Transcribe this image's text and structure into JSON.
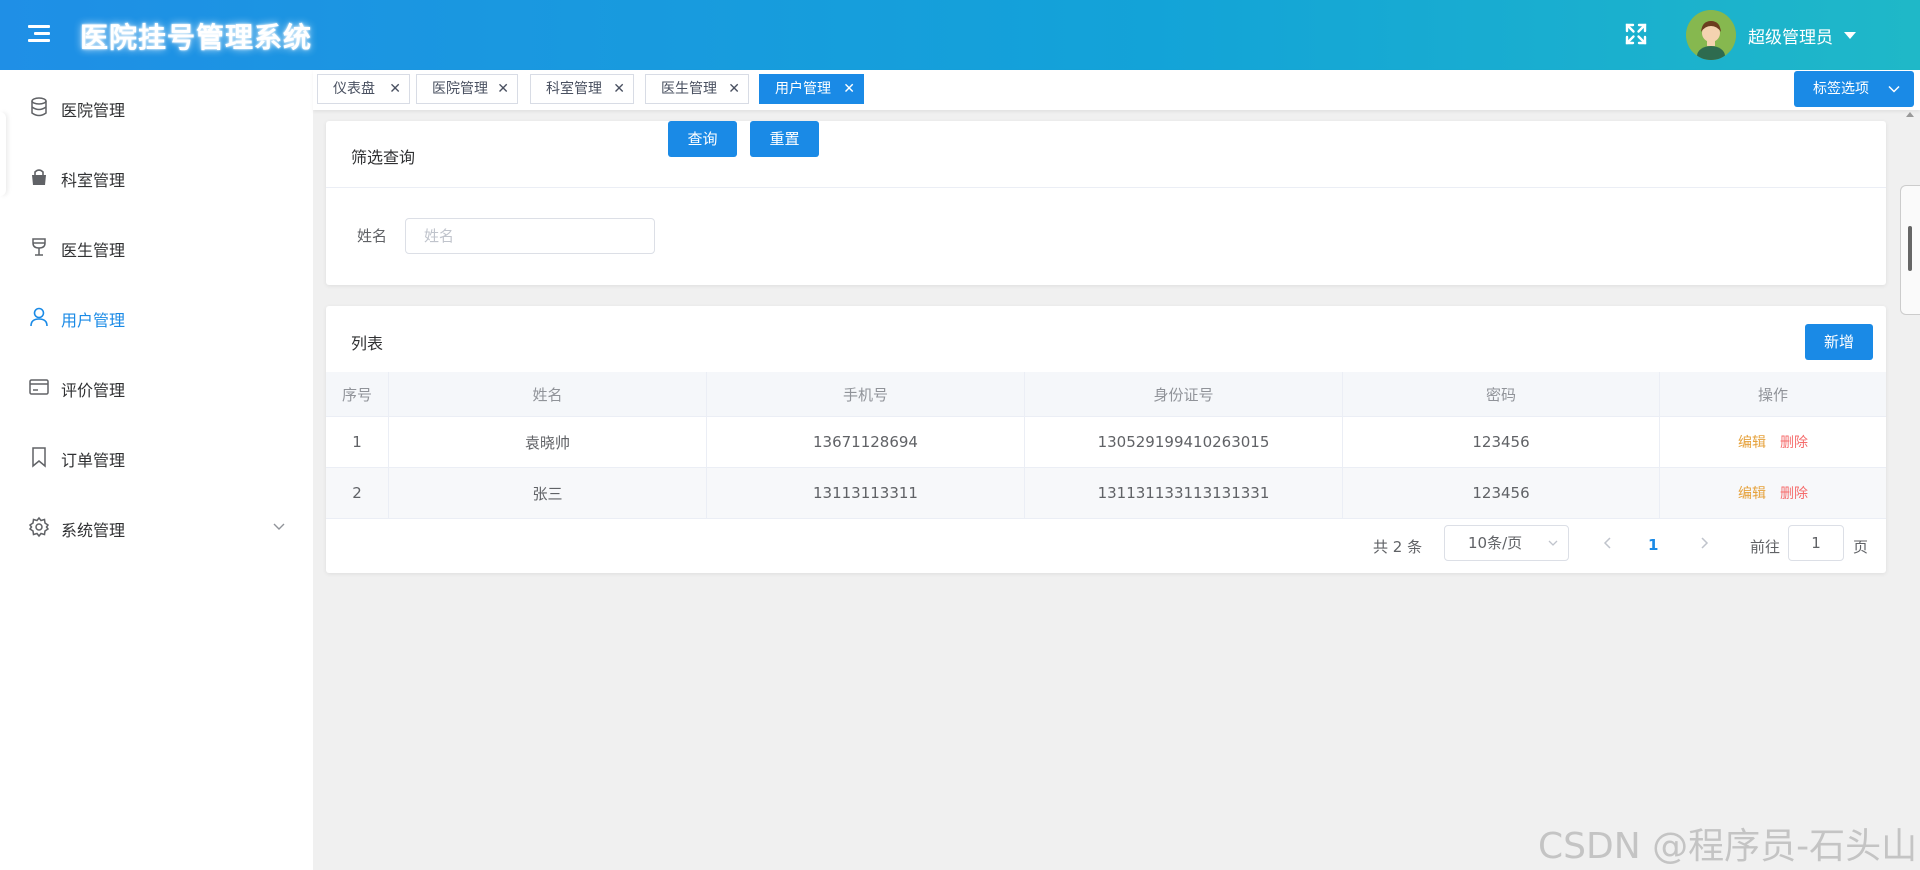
{
  "header": {
    "title": "医院挂号管理系统",
    "user_name": "超级管理员",
    "icons": {
      "menu": "menu-toggle-icon",
      "fullscreen": "fullscreen-icon",
      "dropdown": "caret-down-icon"
    }
  },
  "sidebar": {
    "items": [
      {
        "label": "医院管理",
        "icon": "database-icon"
      },
      {
        "label": "科室管理",
        "icon": "bag-icon"
      },
      {
        "label": "医生管理",
        "icon": "glass-icon"
      },
      {
        "label": "用户管理",
        "icon": "user-icon",
        "active": true
      },
      {
        "label": "评价管理",
        "icon": "card-icon"
      },
      {
        "label": "订单管理",
        "icon": "bookmark-icon"
      },
      {
        "label": "系统管理",
        "icon": "gear-icon",
        "expandable": true
      }
    ]
  },
  "tabs": {
    "items": [
      {
        "label": "仪表盘"
      },
      {
        "label": "医院管理"
      },
      {
        "label": "科室管理"
      },
      {
        "label": "医生管理"
      },
      {
        "label": "用户管理",
        "active": true
      }
    ],
    "options_label": "标签选项"
  },
  "filter": {
    "title": "筛选查询",
    "name_label": "姓名",
    "name_placeholder": "姓名",
    "name_value": "",
    "query_button": "查询",
    "reset_button": "重置"
  },
  "list": {
    "title": "列表",
    "add_button": "新增",
    "columns": [
      "序号",
      "姓名",
      "手机号",
      "身份证号",
      "密码",
      "操作"
    ],
    "rows": [
      {
        "index": "1",
        "name": "袁晓帅",
        "phone": "13671128694",
        "id_card": "130529199410263015",
        "password": "123456"
      },
      {
        "index": "2",
        "name": "张三",
        "phone": "13113113311",
        "id_card": "131131133113131331",
        "password": "123456"
      }
    ],
    "edit_label": "编辑",
    "delete_label": "删除"
  },
  "pagination": {
    "total_text": "共 2 条",
    "page_size": "10条/页",
    "current_page": "1",
    "goto_label": "前往",
    "goto_value": "1",
    "page_suffix": "页"
  },
  "watermark": "CSDN @程序员-石头山",
  "colors": {
    "primary": "#1a8ae6",
    "header_start": "#1f8fe6",
    "header_end": "#1fb8c8",
    "edit": "#e6a23c",
    "delete": "#f56c6c"
  }
}
